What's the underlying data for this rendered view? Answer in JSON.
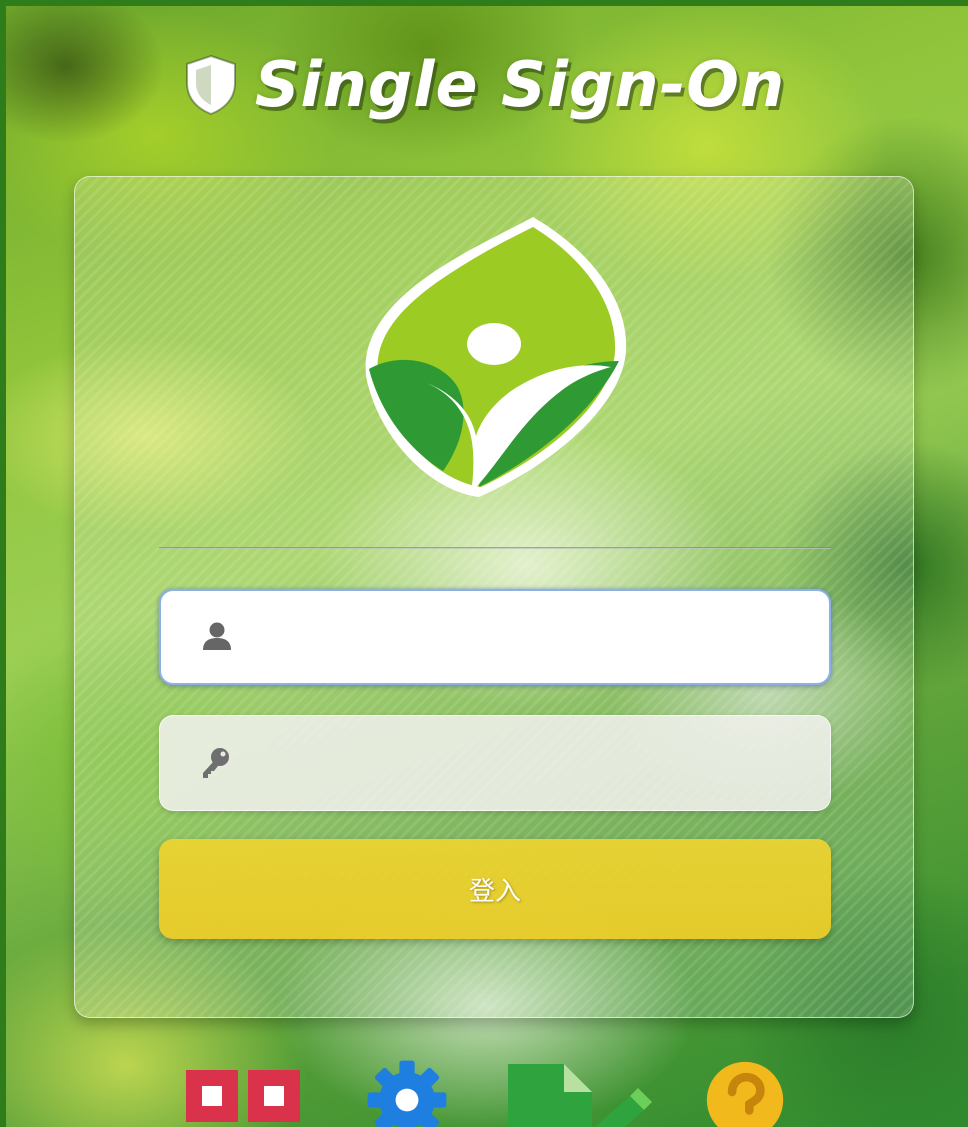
{
  "header": {
    "title": "Single Sign-On"
  },
  "login": {
    "username_value": "",
    "password_value": "",
    "submit_label": "登入"
  },
  "icons": {
    "title_icon": "shield-icon",
    "logo": "leaf-person-logo",
    "username_icon": "user-icon",
    "password_icon": "key-icon",
    "bottom": [
      {
        "name": "apps-grid-icon",
        "color": "#d9324a"
      },
      {
        "name": "gear-icon",
        "color": "#1e7fe0"
      },
      {
        "name": "document-edit-icon",
        "color": "#2fa33e"
      },
      {
        "name": "help-icon",
        "color": "#f1b91c"
      }
    ]
  },
  "colors": {
    "button": "#eacc28",
    "focus_border": "#8fb0e6",
    "logo_light_green": "#9ccb24",
    "logo_dark_green": "#2f9a34"
  }
}
